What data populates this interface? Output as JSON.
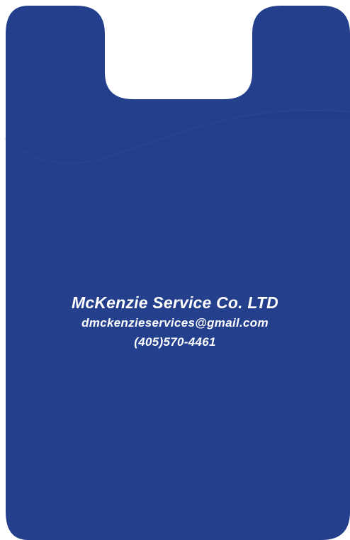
{
  "colors": {
    "card_blue": "#243f8c",
    "pocket_shadow": "#1f387f",
    "text": "#ffffff"
  },
  "card": {
    "company_name": "McKenzie Service Co. LTD",
    "email": "dmckenzieservices@gmail.com",
    "phone": "(405)570-4461"
  }
}
